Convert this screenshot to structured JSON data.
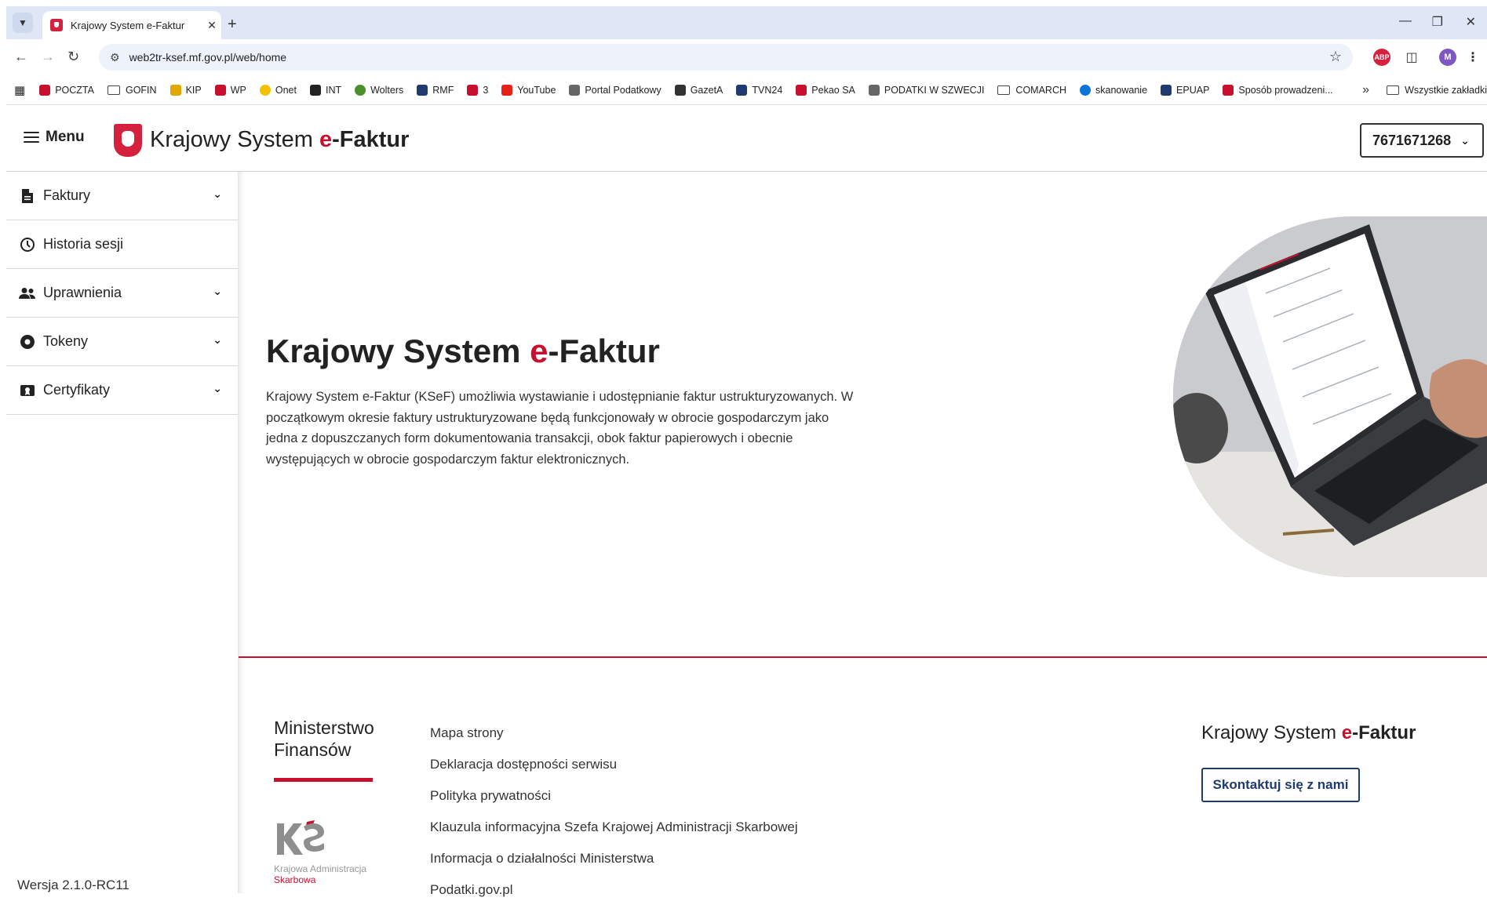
{
  "browser": {
    "tab_title": "Krajowy System e-Faktur",
    "url": "web2tr-ksef.mf.gov.pl/web/home",
    "bookmarks": [
      {
        "label": "POCZTA",
        "icon": "e-letter-icon",
        "color": "#c8102e"
      },
      {
        "label": "GOFIN",
        "icon": "folder-icon",
        "color": "#444444"
      },
      {
        "label": "KIP",
        "icon": "shield-icon",
        "color": "#e0a800"
      },
      {
        "label": "WP",
        "icon": "wp-logo-icon",
        "color": "#c8102e"
      },
      {
        "label": "Onet",
        "icon": "circle-icon",
        "color": "#f2c200"
      },
      {
        "label": "INT",
        "icon": "int-logo-icon",
        "color": "#222222"
      },
      {
        "label": "Wolters",
        "icon": "globe-icon",
        "color": "#4a8f2a"
      },
      {
        "label": "RMF",
        "icon": "rmf-logo-icon",
        "color": "#1e3a6e"
      },
      {
        "label": "3",
        "icon": "target-icon",
        "color": "#c8102e"
      },
      {
        "label": "YouTube",
        "icon": "youtube-icon",
        "color": "#e62117"
      },
      {
        "label": "Portal Podatkowy",
        "icon": "feather-icon",
        "color": "#666666"
      },
      {
        "label": "GazetA",
        "icon": "g-letter-icon",
        "color": "#333333"
      },
      {
        "label": "TVN24",
        "icon": "tvn24-icon",
        "color": "#1e3a6e"
      },
      {
        "label": "Pekao SA",
        "icon": "pekao-icon",
        "color": "#c8102e"
      },
      {
        "label": "PODATKI W SZWECJI",
        "icon": "person-icon",
        "color": "#666666"
      },
      {
        "label": "COMARCH",
        "icon": "folder-icon",
        "color": "#444444"
      },
      {
        "label": "skanowanie",
        "icon": "hp-logo-icon",
        "color": "#0a74da"
      },
      {
        "label": "EPUAP",
        "icon": "epuap-icon",
        "color": "#1e3a6e"
      },
      {
        "label": "Sposób prowadzeni...",
        "icon": "g-square-icon",
        "color": "#c8102e"
      }
    ],
    "bookmarks_more": "»",
    "all_bookmarks": "Wszystkie zakładki",
    "profile_initial": "M",
    "adblock_label": "ABP"
  },
  "header": {
    "menu_label": "Menu",
    "title_prefix": "Krajowy System",
    "title_e": "e",
    "title_suffix": "-Faktur",
    "nip": "7671671268"
  },
  "sidebar": {
    "items": [
      {
        "label": "Faktury",
        "icon": "document-icon",
        "expandable": true
      },
      {
        "label": "Historia sesji",
        "icon": "clock-icon",
        "expandable": false
      },
      {
        "label": "Uprawnienia",
        "icon": "users-icon",
        "expandable": true
      },
      {
        "label": "Tokeny",
        "icon": "token-icon",
        "expandable": true
      },
      {
        "label": "Certyfikaty",
        "icon": "certificate-icon",
        "expandable": true
      }
    ],
    "version": "Wersja 2.1.0-RC11"
  },
  "hero": {
    "title_prefix": "Krajowy System ",
    "title_e": "e",
    "title_suffix": "-Faktur",
    "description": "Krajowy System e-Faktur (KSeF) umożliwia wystawianie i udostępnianie faktur ustrukturyzowanych. W początkowym okresie faktury ustrukturyzowane będą funkcjonowały w obrocie gospodarczym jako jedna z dopuszczanych form dokumentowania transakcji, obok faktur papierowych i obecnie występujących w obrocie gospodarczym faktur elektronicznych."
  },
  "footer": {
    "ministry_line1": "Ministerstwo",
    "ministry_line2": "Finansów",
    "kas_line1": "Krajowa Administracja",
    "kas_line2": "Skarbowa",
    "links": [
      "Mapa strony",
      "Deklaracja dostępności serwisu",
      "Polityka prywatności",
      "Klauzula informacyjna Szefa Krajowej Administracji Skarbowej",
      "Informacja o działalności Ministerstwa",
      "Podatki.gov.pl"
    ],
    "brand_prefix": "Krajowy System ",
    "brand_e": "e",
    "brand_suffix": "-Faktur",
    "contact_button": "Skontaktuj się z nami"
  },
  "colors": {
    "accent_red": "#c8102e",
    "navy": "#1e3a6e"
  }
}
